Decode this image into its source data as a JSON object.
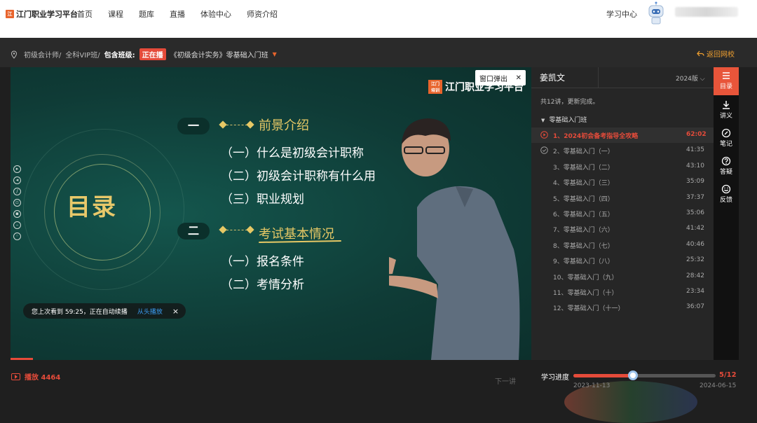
{
  "nav": {
    "logo_text": "江门职业学习平台",
    "links": [
      "首页",
      "课程",
      "题库",
      "直播",
      "体验中心",
      "师资介绍"
    ],
    "study_center": "学习中心"
  },
  "breadcrumb": {
    "items": [
      "初级会计师/",
      "全科VIP班/"
    ],
    "class_label": "包含班级:",
    "live_badge": "正在播",
    "course_name": "《初级会计实务》零基础入门班",
    "back_label": "返回网校"
  },
  "video": {
    "popout_label": "窗口弹出",
    "watermark": "江门职业学习平台",
    "watermark_mark": "江门\n培训",
    "catalog_title": "目录",
    "section1": {
      "num": "一",
      "title": "前景介绍",
      "items": [
        "（一）什么是初级会计职称",
        "（二）初级会计职称有什么用",
        "（三）职业规划"
      ]
    },
    "section2": {
      "num": "二",
      "title": "考试基本情况",
      "items": [
        "（一）报名条件",
        "（二）考情分析"
      ]
    },
    "resume": {
      "text": "您上次看到 59:25，正在自动续播",
      "replay": "从头播放",
      "close": "×"
    }
  },
  "bottom": {
    "play_label": "播放 4464",
    "next_label": "下一讲",
    "study_progress_label": "学习进度",
    "progress_fraction": 0.42,
    "ratio": "5/12",
    "start_date": "2023-11-13",
    "end_date": "2024-06-15"
  },
  "panel": {
    "teacher": "姜凯文",
    "year": "2024版",
    "info": "共12讲，更新完成。",
    "group": "零基础入门班",
    "lessons": [
      {
        "title": "1、2024初会备考指导全攻略",
        "dur": "62:02"
      },
      {
        "title": "2、零基础入门（一）",
        "dur": "41:35"
      },
      {
        "title": "3、零基础入门（二）",
        "dur": "43:10"
      },
      {
        "title": "4、零基础入门（三）",
        "dur": "35:09"
      },
      {
        "title": "5、零基础入门（四）",
        "dur": "37:37"
      },
      {
        "title": "6、零基础入门（五）",
        "dur": "35:06"
      },
      {
        "title": "7、零基础入门（六）",
        "dur": "41:42"
      },
      {
        "title": "8、零基础入门（七）",
        "dur": "40:46"
      },
      {
        "title": "9、零基础入门（八）",
        "dur": "25:32"
      },
      {
        "title": "10、零基础入门（九）",
        "dur": "28:42"
      },
      {
        "title": "11、零基础入门（十）",
        "dur": "23:34"
      },
      {
        "title": "12、零基础入门（十一）",
        "dur": "36:07"
      }
    ]
  },
  "rail": [
    "目录",
    "讲义",
    "笔记",
    "答疑",
    "反馈"
  ]
}
